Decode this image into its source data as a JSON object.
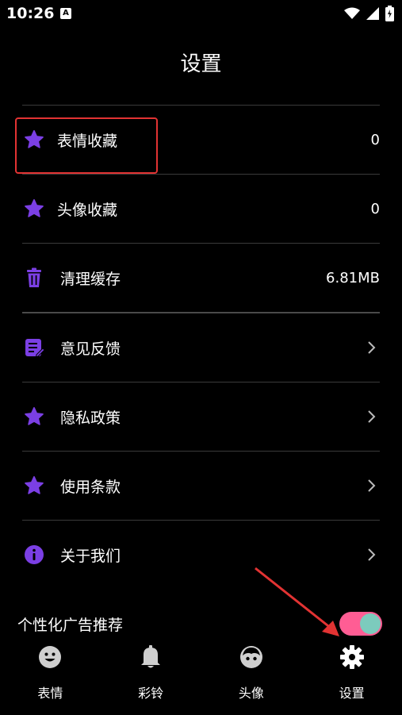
{
  "status_bar": {
    "time": "10:26",
    "notification_badge": "A"
  },
  "header": {
    "title": "设置"
  },
  "settings": {
    "favorites_expressions": {
      "label": "表情收藏",
      "value": "0"
    },
    "favorites_avatars": {
      "label": "头像收藏",
      "value": "0"
    },
    "clear_cache": {
      "label": "清理缓存",
      "value": "6.81MB"
    },
    "feedback": {
      "label": "意见反馈"
    },
    "privacy_policy": {
      "label": "隐私政策"
    },
    "terms_of_use": {
      "label": "使用条款"
    },
    "about_us": {
      "label": "关于我们"
    }
  },
  "personalized_ads": {
    "label": "个性化广告推荐",
    "enabled": true
  },
  "tab_bar": {
    "tabs": [
      {
        "label": "表情",
        "icon": "smiley-icon"
      },
      {
        "label": "彩铃",
        "icon": "bell-icon"
      },
      {
        "label": "头像",
        "icon": "avatar-face-icon"
      },
      {
        "label": "设置",
        "icon": "gear-icon",
        "active": true
      }
    ]
  },
  "colors": {
    "accent_purple": "#7b3fe4",
    "toggle_track": "#ff5d94",
    "toggle_knob": "#7ccbbd",
    "annotation_red": "#e23333"
  }
}
